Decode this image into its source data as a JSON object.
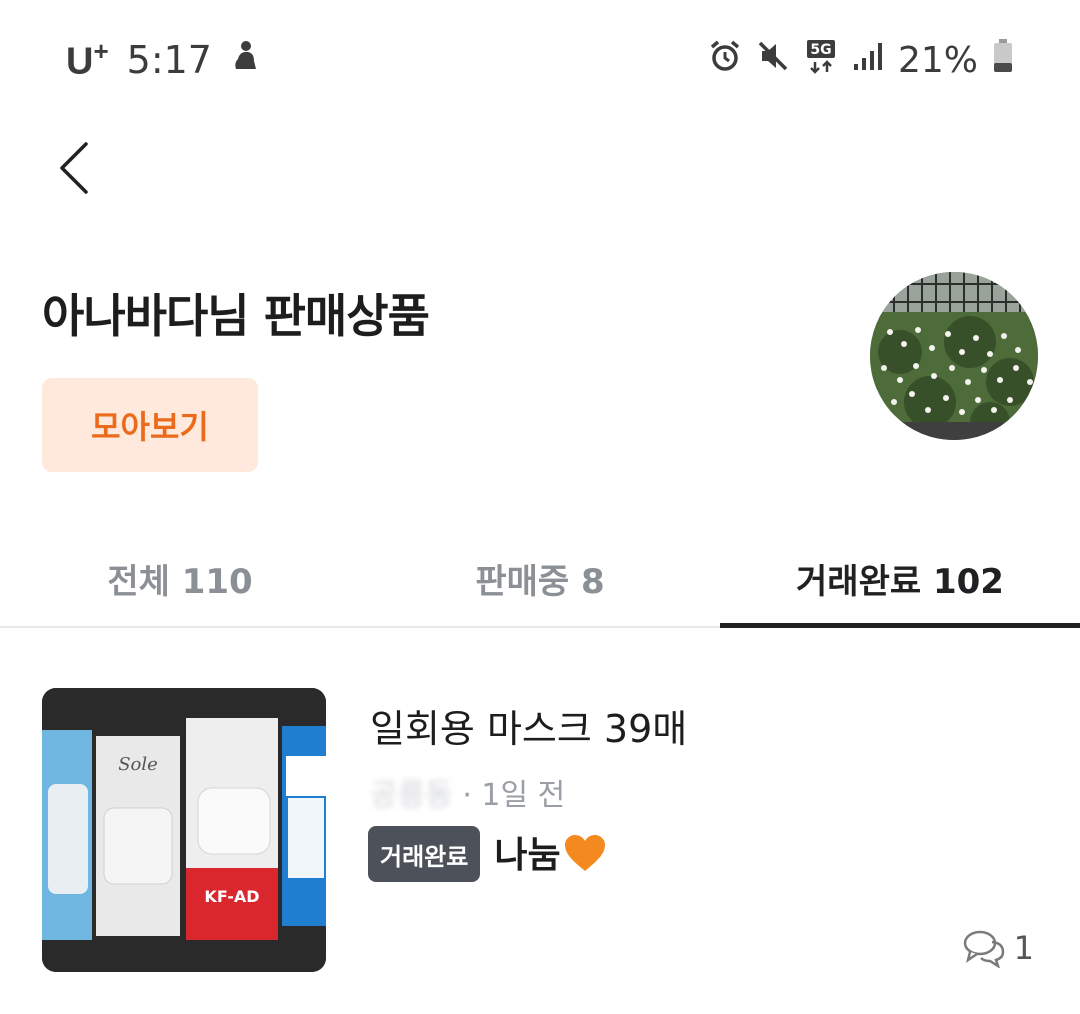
{
  "status_bar": {
    "carrier": "U",
    "carrier_sup": "+",
    "time": "5:17",
    "battery": "21%",
    "network": "5G"
  },
  "header": {
    "title": "아나바다님 판매상품",
    "gather_label": "모아보기"
  },
  "tabs": [
    {
      "label": "전체 110",
      "active": false
    },
    {
      "label": "판매중 8",
      "active": false
    },
    {
      "label": "거래완료 102",
      "active": true
    }
  ],
  "items": [
    {
      "title": "일회용 마스크 39매",
      "location": "공릉동",
      "time_ago": "· 1일 전",
      "status": "거래완료",
      "price": "나눔",
      "chat_count": "1"
    }
  ],
  "colors": {
    "accent": "#ec6a1c",
    "accent_bg": "#ffe9dc",
    "badge": "#4d5159"
  }
}
